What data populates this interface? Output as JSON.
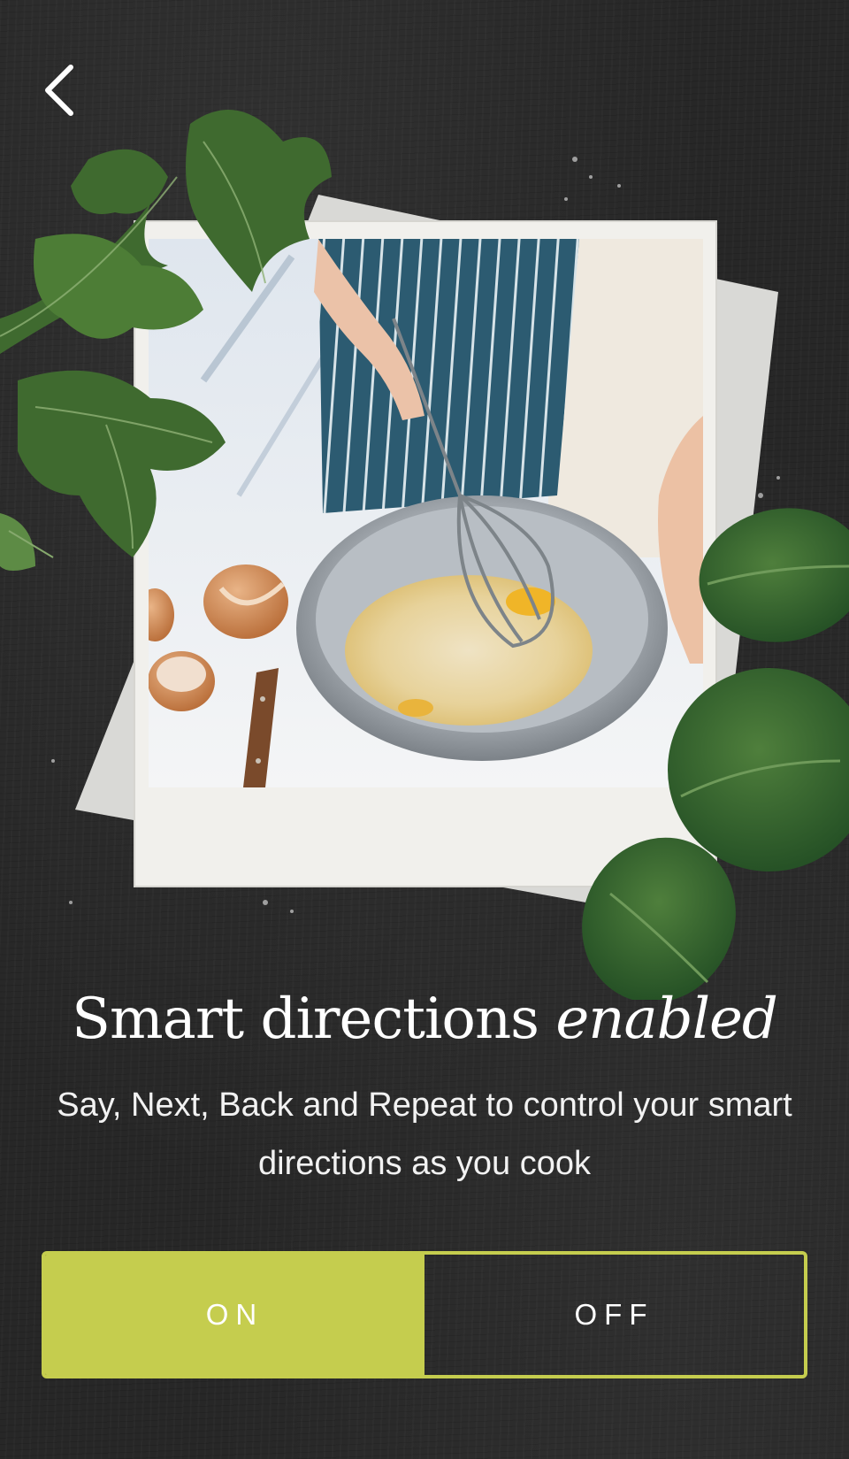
{
  "nav": {
    "back_icon": "chevron-left-icon"
  },
  "hero": {
    "description": "Photo of hands whisking eggs in a steel bowl on a kitchen counter, set as a polaroid over a dark background with parsley and spinach leaves"
  },
  "content": {
    "title_main": "Smart directions",
    "title_emphasis": "enabled",
    "subtitle": "Say, Next, Back and Repeat to control your smart directions as you cook"
  },
  "toggle": {
    "on_label": "ON",
    "off_label": "OFF",
    "selected": "ON"
  },
  "colors": {
    "accent": "#c5cd4e",
    "background": "#272727",
    "text": "#ffffff"
  }
}
